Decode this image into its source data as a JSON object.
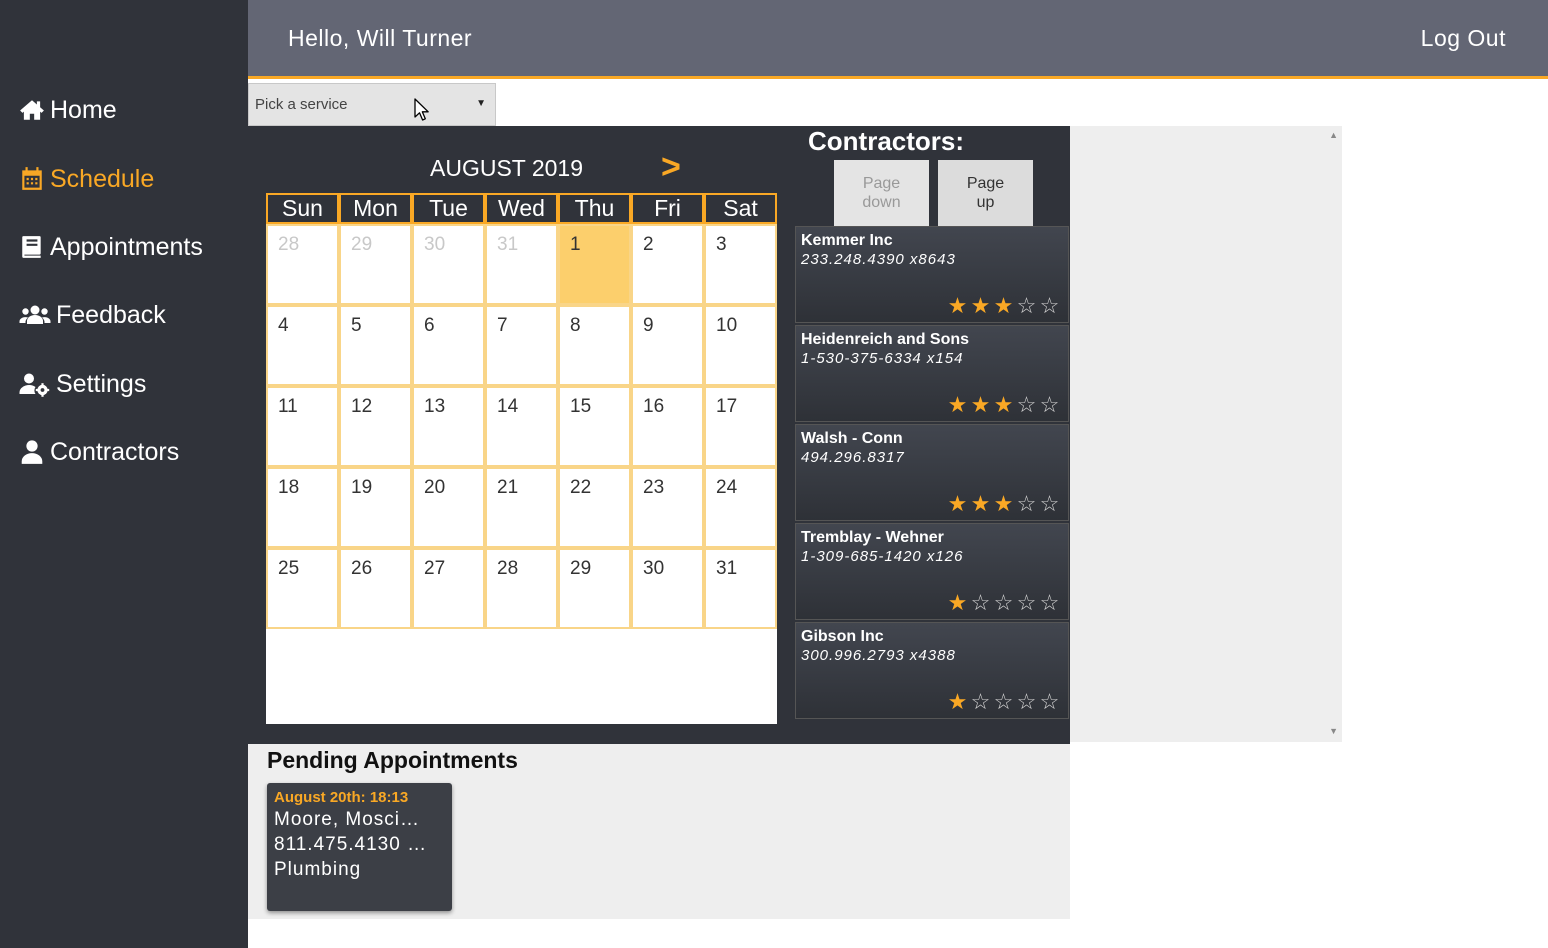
{
  "header": {
    "greeting": "Hello, Will Turner",
    "logout_label": "Log Out"
  },
  "sidebar": {
    "items": [
      {
        "label": "Home",
        "icon": "home-icon",
        "active": false
      },
      {
        "label": "Schedule",
        "icon": "calendar-icon",
        "active": true
      },
      {
        "label": "Appointments",
        "icon": "book-icon",
        "active": false
      },
      {
        "label": "Feedback",
        "icon": "users-icon",
        "active": false
      },
      {
        "label": "Settings",
        "icon": "user-gear-icon",
        "active": false
      },
      {
        "label": "Contractors",
        "icon": "user-icon",
        "active": false
      }
    ]
  },
  "service_select": {
    "value": "Pick a service"
  },
  "calendar": {
    "month_label": "AUGUST 2019",
    "next_label": ">",
    "weekdays": [
      "Sun",
      "Mon",
      "Tue",
      "Wed",
      "Thu",
      "Fri",
      "Sat"
    ],
    "weeks": [
      [
        "28",
        "29",
        "30",
        "31",
        "1",
        "2",
        "3"
      ],
      [
        "4",
        "5",
        "6",
        "7",
        "8",
        "9",
        "10"
      ],
      [
        "11",
        "12",
        "13",
        "14",
        "15",
        "16",
        "17"
      ],
      [
        "18",
        "19",
        "20",
        "21",
        "22",
        "23",
        "24"
      ],
      [
        "25",
        "26",
        "27",
        "28",
        "29",
        "30",
        "31"
      ]
    ],
    "selected_day": "1"
  },
  "contractors": {
    "title": "Contractors:",
    "page_down_label": "Page down",
    "page_up_label": "Page up",
    "items": [
      {
        "name": "Kemmer Inc",
        "phone": "233.248.4390 x8643",
        "rating": 3
      },
      {
        "name": "Heidenreich and Sons",
        "phone": "1-530-375-6334 x154",
        "rating": 3
      },
      {
        "name": "Walsh - Conn",
        "phone": "494.296.8317",
        "rating": 3
      },
      {
        "name": "Tremblay - Wehner",
        "phone": "1-309-685-1420 x126",
        "rating": 1
      },
      {
        "name": "Gibson Inc",
        "phone": "300.996.2793 x4388",
        "rating": 1
      }
    ]
  },
  "pending": {
    "title": "Pending Appointments",
    "appointments": [
      {
        "when": "August 20th: 18:13",
        "contractor": "Moore, Mosci…",
        "phone": "811.475.4130 …",
        "service": "Plumbing"
      }
    ]
  },
  "colors": {
    "accent": "#f9a825",
    "sidebar": "#30333a",
    "header": "#636674"
  }
}
